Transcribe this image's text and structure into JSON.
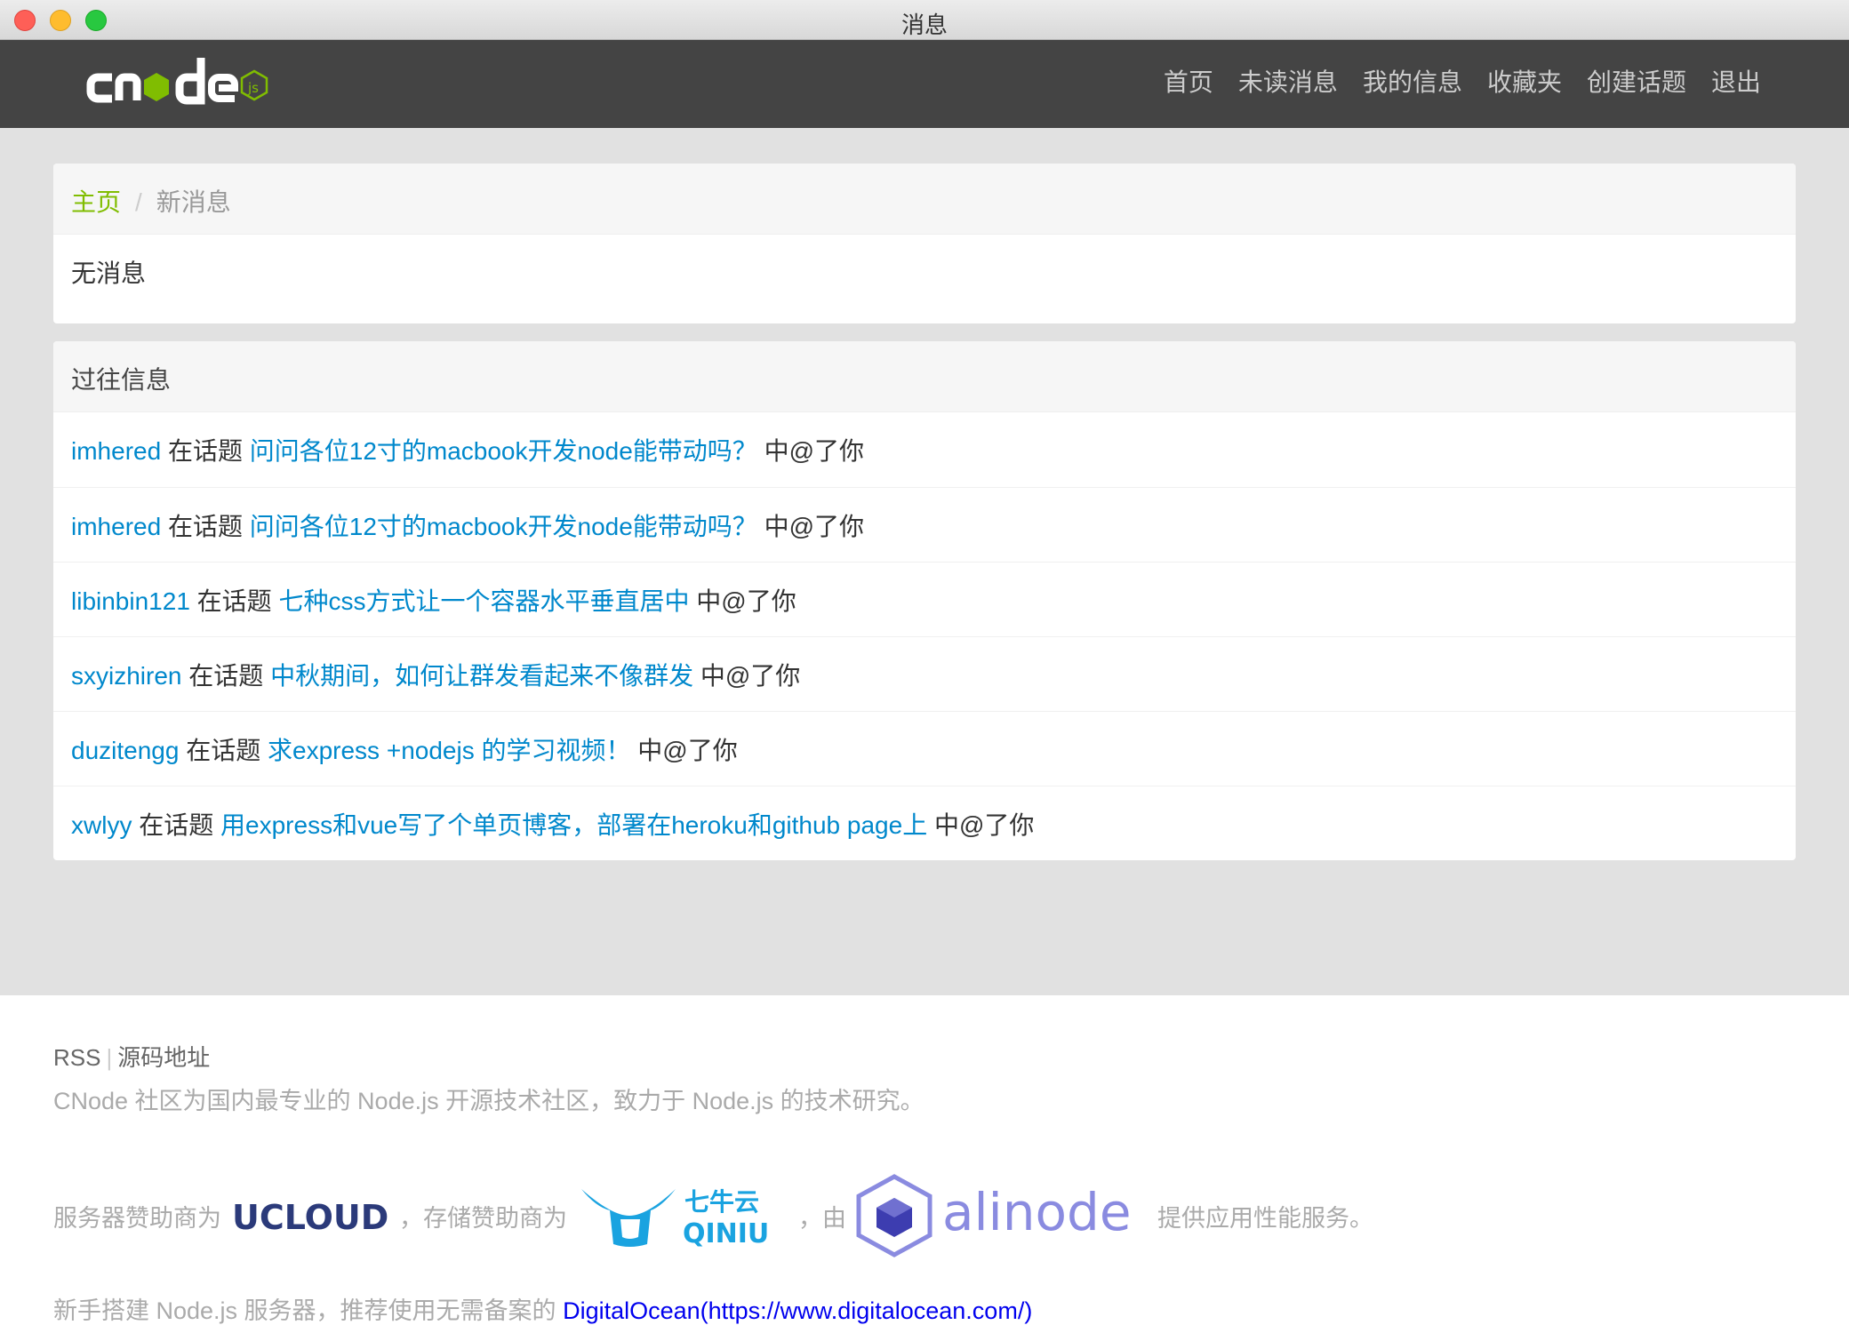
{
  "window": {
    "title": "消息"
  },
  "navbar": {
    "logo_alt": "cnode js",
    "links": [
      "首页",
      "未读消息",
      "我的信息",
      "收藏夹",
      "创建话题",
      "退出"
    ]
  },
  "breadcrumb": {
    "home": "主页",
    "separator": "/",
    "current": "新消息"
  },
  "new_messages": {
    "empty_text": "无消息"
  },
  "past_messages": {
    "title": "过往信息",
    "items": [
      {
        "user": "imhered",
        "connector": "在话题",
        "topic": "问问各位12寸的macbook开发node能带动吗？",
        "suffix": "中@了你"
      },
      {
        "user": "imhered",
        "connector": "在话题",
        "topic": "问问各位12寸的macbook开发node能带动吗？",
        "suffix": "中@了你"
      },
      {
        "user": "libinbin121",
        "connector": "在话题",
        "topic": "七种css方式让一个容器水平垂直居中",
        "suffix": "中@了你"
      },
      {
        "user": "sxyizhiren",
        "connector": "在话题",
        "topic": "中秋期间，如何让群发看起来不像群发",
        "suffix": "中@了你"
      },
      {
        "user": "duzitengg",
        "connector": "在话题",
        "topic": "求express +nodejs 的学习视频！",
        "suffix": "中@了你"
      },
      {
        "user": "xwlyy",
        "connector": "在话题",
        "topic": "用express和vue写了个单页博客，部署在heroku和github page上",
        "suffix": "中@了你"
      }
    ]
  },
  "footer": {
    "rss": "RSS",
    "divider": "|",
    "source": "源码地址",
    "description": "CNode 社区为国内最专业的 Node.js 开源技术社区，致力于 Node.js 的技术研究。",
    "sponsor_prefix": "服务器赞助商为",
    "ucloud": "UCLOUD",
    "storage_prefix": "，存储赞助商为",
    "qiniu_cn": "七牛云",
    "qiniu_en": "QINIU",
    "by_prefix": "，由",
    "alinode": "alinode",
    "perf_suffix": "提供应用性能服务。",
    "do_prefix": "新手搭建 Node.js 服务器，推荐使用无需备案的",
    "do_link": "DigitalOcean(https://www.digitalocean.com/)"
  },
  "colors": {
    "navbar": "#444444",
    "link_blue": "#0088cc",
    "breadcrumb_green": "#80bd01",
    "node_green": "#80bd01"
  }
}
